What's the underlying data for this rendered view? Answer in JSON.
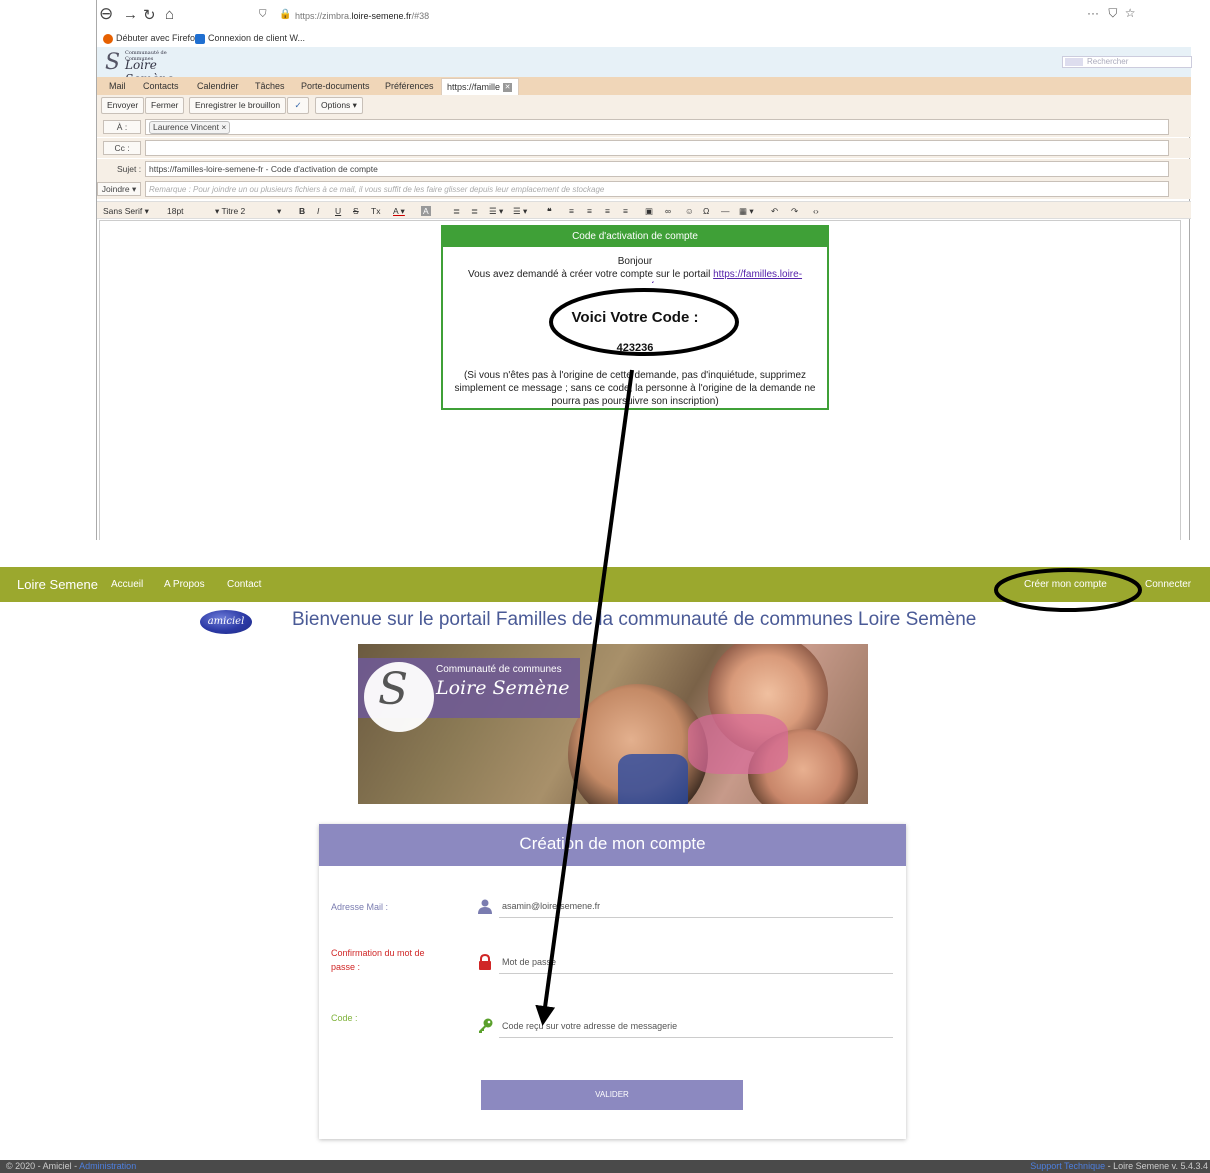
{
  "firefox": {
    "url_prefix": "https://zimbra.",
    "url_domain": "loire-semene.fr",
    "url_suffix": "/#38",
    "menu_glyph": "···",
    "bookmarks": [
      "Débuter avec Firefox",
      "Connexion de client W..."
    ]
  },
  "zimbra": {
    "logo_small": "Communauté de Communes",
    "logo_name": "Loire Semène",
    "search_placeholder": "Rechercher",
    "tabs": [
      "Mail",
      "Contacts",
      "Calendrier",
      "Tâches",
      "Porte-documents",
      "Préférences"
    ],
    "active_tab": "https://famille",
    "toolbar": {
      "send": "Envoyer",
      "close": "Fermer",
      "save_draft": "Enregistrer le brouillon",
      "options": "Options"
    },
    "to_label": "À :",
    "to_value": "Laurence Vincent",
    "cc_label": "Cc :",
    "subject_label": "Sujet :",
    "subject_value": "https://familles-loire-semene-fr - Code d'activation de compte",
    "attach_label": "Joindre",
    "attach_placeholder": "Remarque : Pour joindre un ou plusieurs fichiers à ce mail, il vous suffit de les faire glisser depuis leur emplacement de stockage",
    "font": "Sans Serif",
    "size": "18pt",
    "heading": "Titre 2"
  },
  "email": {
    "header": "Code d'activation de compte",
    "greeting": "Bonjour",
    "line1": "Vous avez demandé à créer votre compte sur le portail",
    "link": "https://familles.loire-semene.fr",
    "code_title": "Voici Votre Code :",
    "code": "423236",
    "disclaimer": "(Si vous n'êtes pas à l'origine de cette demande, pas d'inquiétude, supprimez simplement ce message ; sans ce code, la personne à l'origine de la demande ne pourra pas poursuivre son inscription)"
  },
  "portal": {
    "brand": "Loire Semene",
    "nav": [
      "Accueil",
      "A Propos",
      "Contact"
    ],
    "create_account": "Créer mon compte",
    "connect": "Connecter",
    "amiciel_logo": "amiciel",
    "welcome": "Bienvenue sur le portail Familles de la communauté de communes Loire Semène",
    "banner_small": "Communauté de communes",
    "banner_name": "Loire Semène",
    "form_title": "Création de mon compte",
    "email_label": "Adresse Mail :",
    "email_value": "asamin@loire-semene.fr",
    "pwd_label": "Confirmation du mot de passe :",
    "pwd_placeholder": "Mot de passe",
    "code_label": "Code :",
    "code_placeholder": "Code reçu sur votre adresse de messagerie",
    "validate": "VALIDER"
  },
  "footer": {
    "left": "© 2020 - Amiciel -",
    "admin": "Administration",
    "support": "Support Technique",
    "right": "- Loire Semene v. 5.4.3.4"
  },
  "colors": {
    "nav": "#9ba82e",
    "card_header": "#8c89c0",
    "email_green": "#3fa037",
    "tab_bar": "#f0d6b8"
  }
}
